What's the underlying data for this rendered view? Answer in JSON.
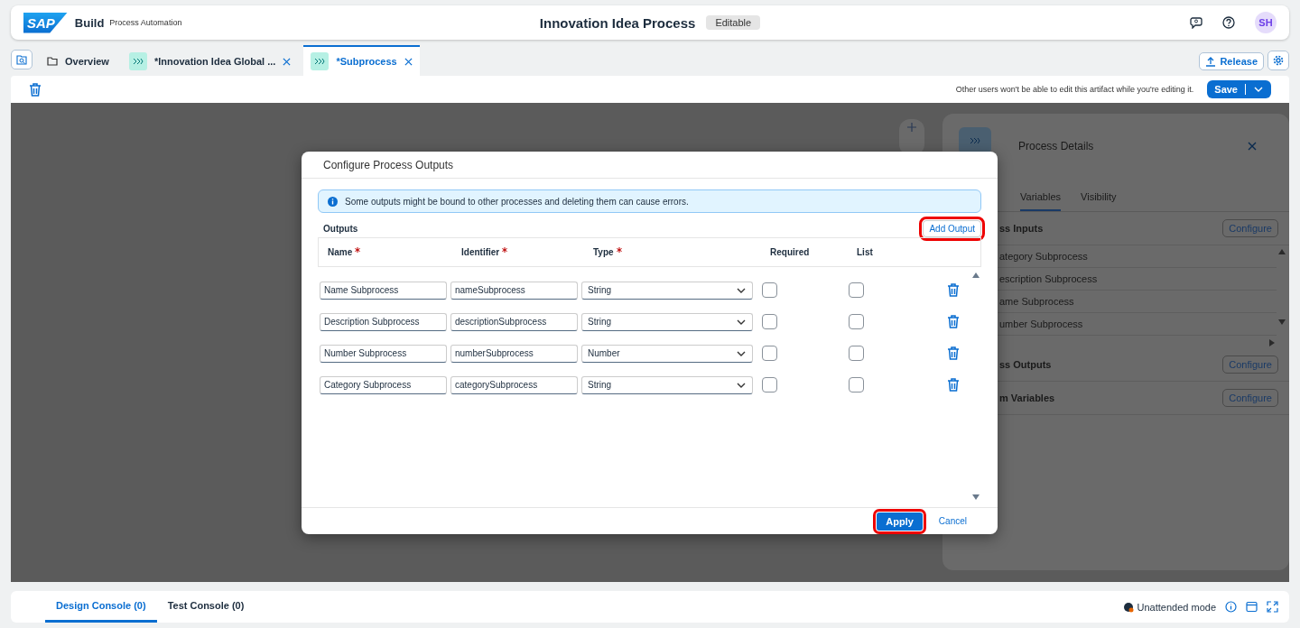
{
  "header": {
    "logo": "SAP",
    "product": "Build",
    "subtitle": "Process Automation",
    "title": "Innovation Idea Process",
    "status": "Editable",
    "avatar": "SH"
  },
  "tabs": [
    {
      "kind": "folder",
      "label": "Overview",
      "selected": false,
      "closable": false
    },
    {
      "kind": "process",
      "label": "*Innovation Idea Global ...",
      "selected": false,
      "closable": true
    },
    {
      "kind": "process",
      "label": "*Subprocess",
      "selected": true,
      "closable": true
    }
  ],
  "release_button": "Release",
  "toolbar": {
    "notice": "Other users won't be able to edit this artifact while you're editing it.",
    "save": "Save"
  },
  "details_panel": {
    "title": "Process Details",
    "tabs": [
      {
        "label": "Variables",
        "selected": true
      },
      {
        "label": "Visibility",
        "selected": false
      }
    ],
    "sections": [
      {
        "title": "ss Inputs",
        "action": "Configure",
        "items": [
          "ategory Subprocess",
          "escription Subprocess",
          "ame Subprocess",
          "umber Subprocess"
        ]
      },
      {
        "title": "ss Outputs",
        "action": "Configure"
      },
      {
        "title": "m Variables",
        "action": "Configure"
      }
    ]
  },
  "dialog": {
    "title": "Configure Process Outputs",
    "info": "Some outputs might be bound to other processes and deleting them can cause errors.",
    "section_label": "Outputs",
    "add_button": {
      "label": "Add Output",
      "highlighted": true
    },
    "columns": [
      {
        "label": "Name",
        "required": true
      },
      {
        "label": "Identifier",
        "required": true
      },
      {
        "label": "Type",
        "required": true
      },
      {
        "label": "Required",
        "required": false
      },
      {
        "label": "List",
        "required": false
      }
    ],
    "rows": [
      {
        "name": "Name Subprocess",
        "identifier": "nameSubprocess",
        "type": "String",
        "required": false,
        "list": false
      },
      {
        "name": "Description Subprocess",
        "identifier": "descriptionSubprocess",
        "type": "String",
        "required": false,
        "list": false
      },
      {
        "name": "Number Subprocess",
        "identifier": "numberSubprocess",
        "type": "Number",
        "required": false,
        "list": false
      },
      {
        "name": "Category Subprocess",
        "identifier": "categorySubprocess",
        "type": "String",
        "required": false,
        "list": false
      }
    ],
    "apply_button": {
      "label": "Apply",
      "highlighted": true
    },
    "cancel_button": "Cancel"
  },
  "footer": {
    "tabs": [
      {
        "label": "Design Console (0)",
        "selected": true
      },
      {
        "label": "Test Console (0)",
        "selected": false
      }
    ],
    "mode": "Unattended mode"
  }
}
